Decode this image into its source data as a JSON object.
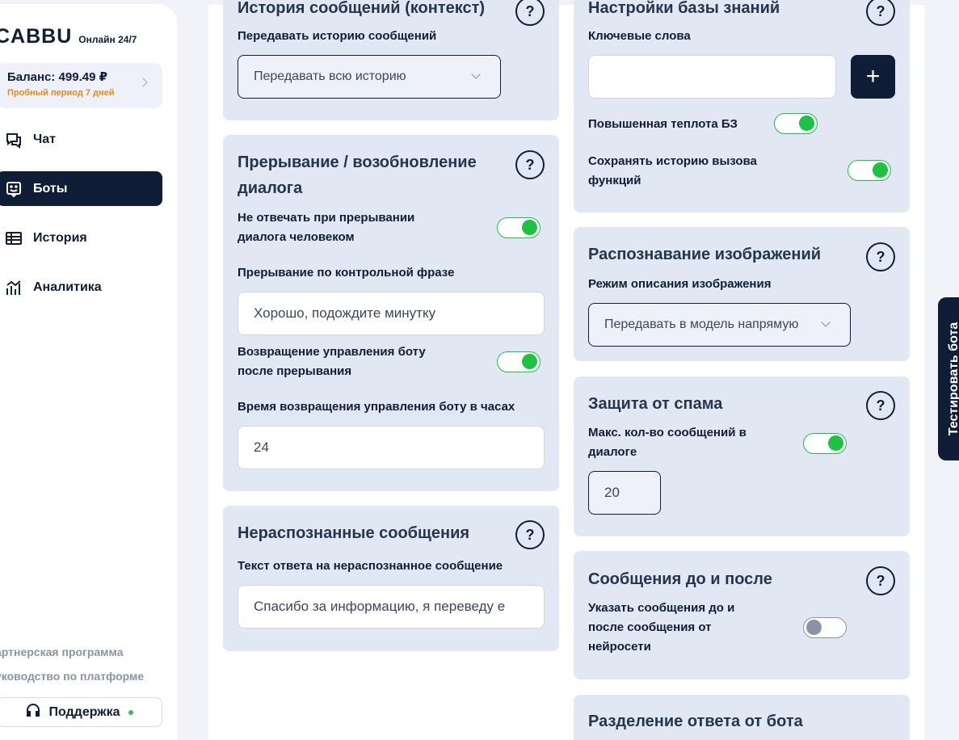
{
  "sidebar": {
    "logo": "CABBU",
    "logo_sub": "Онлайн 24/7",
    "balance": "Баланс: 499.49 ₽",
    "trial": "Пробный период 7 дней",
    "nav": [
      {
        "label": "Чат",
        "icon": "chat-icon"
      },
      {
        "label": "Боты",
        "icon": "bot-icon",
        "active": true
      },
      {
        "label": "История",
        "icon": "table-icon"
      },
      {
        "label": "Аналитика",
        "icon": "analytics-icon"
      }
    ],
    "partner": "артнерская программа",
    "guide": "уководство по платформе",
    "support": "Поддержка"
  },
  "history_card": {
    "title": "История сообщений (контекст)",
    "label": "Передавать историю сообщений",
    "select_value": "Передавать всю историю"
  },
  "interrupt_card": {
    "title_line1": "Прерывание / возобновление",
    "title_line2": "диалога",
    "no_reply_label_1": "Не отвечать при прерывании",
    "no_reply_label_2": "диалога человеком",
    "no_reply_on": true,
    "phrase_label": "Прерывание по контрольной фразе",
    "phrase_value": "Хорошо, подождите минутку",
    "return_label_1": "Возвращение управления боту",
    "return_label_2": "после прерывания",
    "return_on": true,
    "hours_label": "Время возвращения управления боту в часах",
    "hours_value": "24"
  },
  "unrecognized_card": {
    "title": "Нераспознанные сообщения",
    "label": "Текст ответа на нераспознанное сообщение",
    "value": "Спасибо за информацию, я переведу е"
  },
  "kb_card": {
    "title": "Настройки базы знаний",
    "keywords_label": "Ключевые слова",
    "keywords_value": "",
    "plus": "+",
    "temp_label": "Повышенная теплота БЗ",
    "temp_on": true,
    "save_label_1": "Сохранять историю вызова",
    "save_label_2": "функций",
    "save_on": true
  },
  "image_card": {
    "title": "Распознавание изображений",
    "label": "Режим описания изображения",
    "select_value": "Передавать в модель напрямую"
  },
  "spam_card": {
    "title": "Защита от спама",
    "label_1": "Макс. кол-во сообщений в",
    "label_2": "диалоге",
    "on": true,
    "value": "20"
  },
  "before_after_card": {
    "title": "Сообщения до и после",
    "label_1": "Указать сообщения до и",
    "label_2": "после сообщения от",
    "label_3": "нейросети",
    "on": false
  },
  "split_card": {
    "title": "Разделение ответа от бота"
  },
  "help_symbol": "?",
  "test_tab": "Тестировать бота",
  "colors": {
    "primary": "#0f1e36",
    "card_bg": "#e2e8f3",
    "toggle_on": "#1ec142",
    "accent_orange": "#e58a1b"
  }
}
